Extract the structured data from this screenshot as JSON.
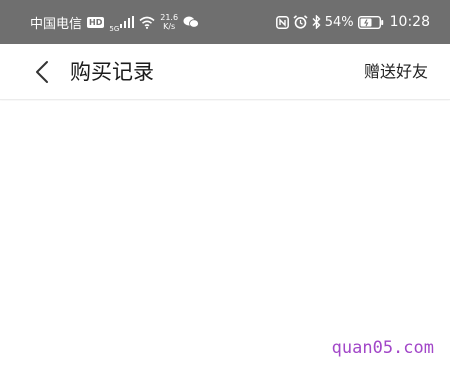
{
  "status_bar": {
    "carrier": "中国电信",
    "hd_badge": "HD",
    "network_type": "5G",
    "speed_value": "21.6",
    "speed_unit": "K/s",
    "battery_percent": "54%",
    "time": "10:28",
    "icons": [
      "hd-badge-icon",
      "signal-icon",
      "wifi-icon",
      "wechat-icon",
      "nfc-icon",
      "alarm-icon",
      "bluetooth-icon",
      "battery-icon"
    ]
  },
  "header": {
    "back_icon": "chevron-left-icon",
    "title": "购买记录",
    "action_label": "赠送好友"
  },
  "watermark": "quan05.com",
  "colors": {
    "status_bar_bg": "#6f6f6f",
    "watermark": "#a247c8"
  }
}
